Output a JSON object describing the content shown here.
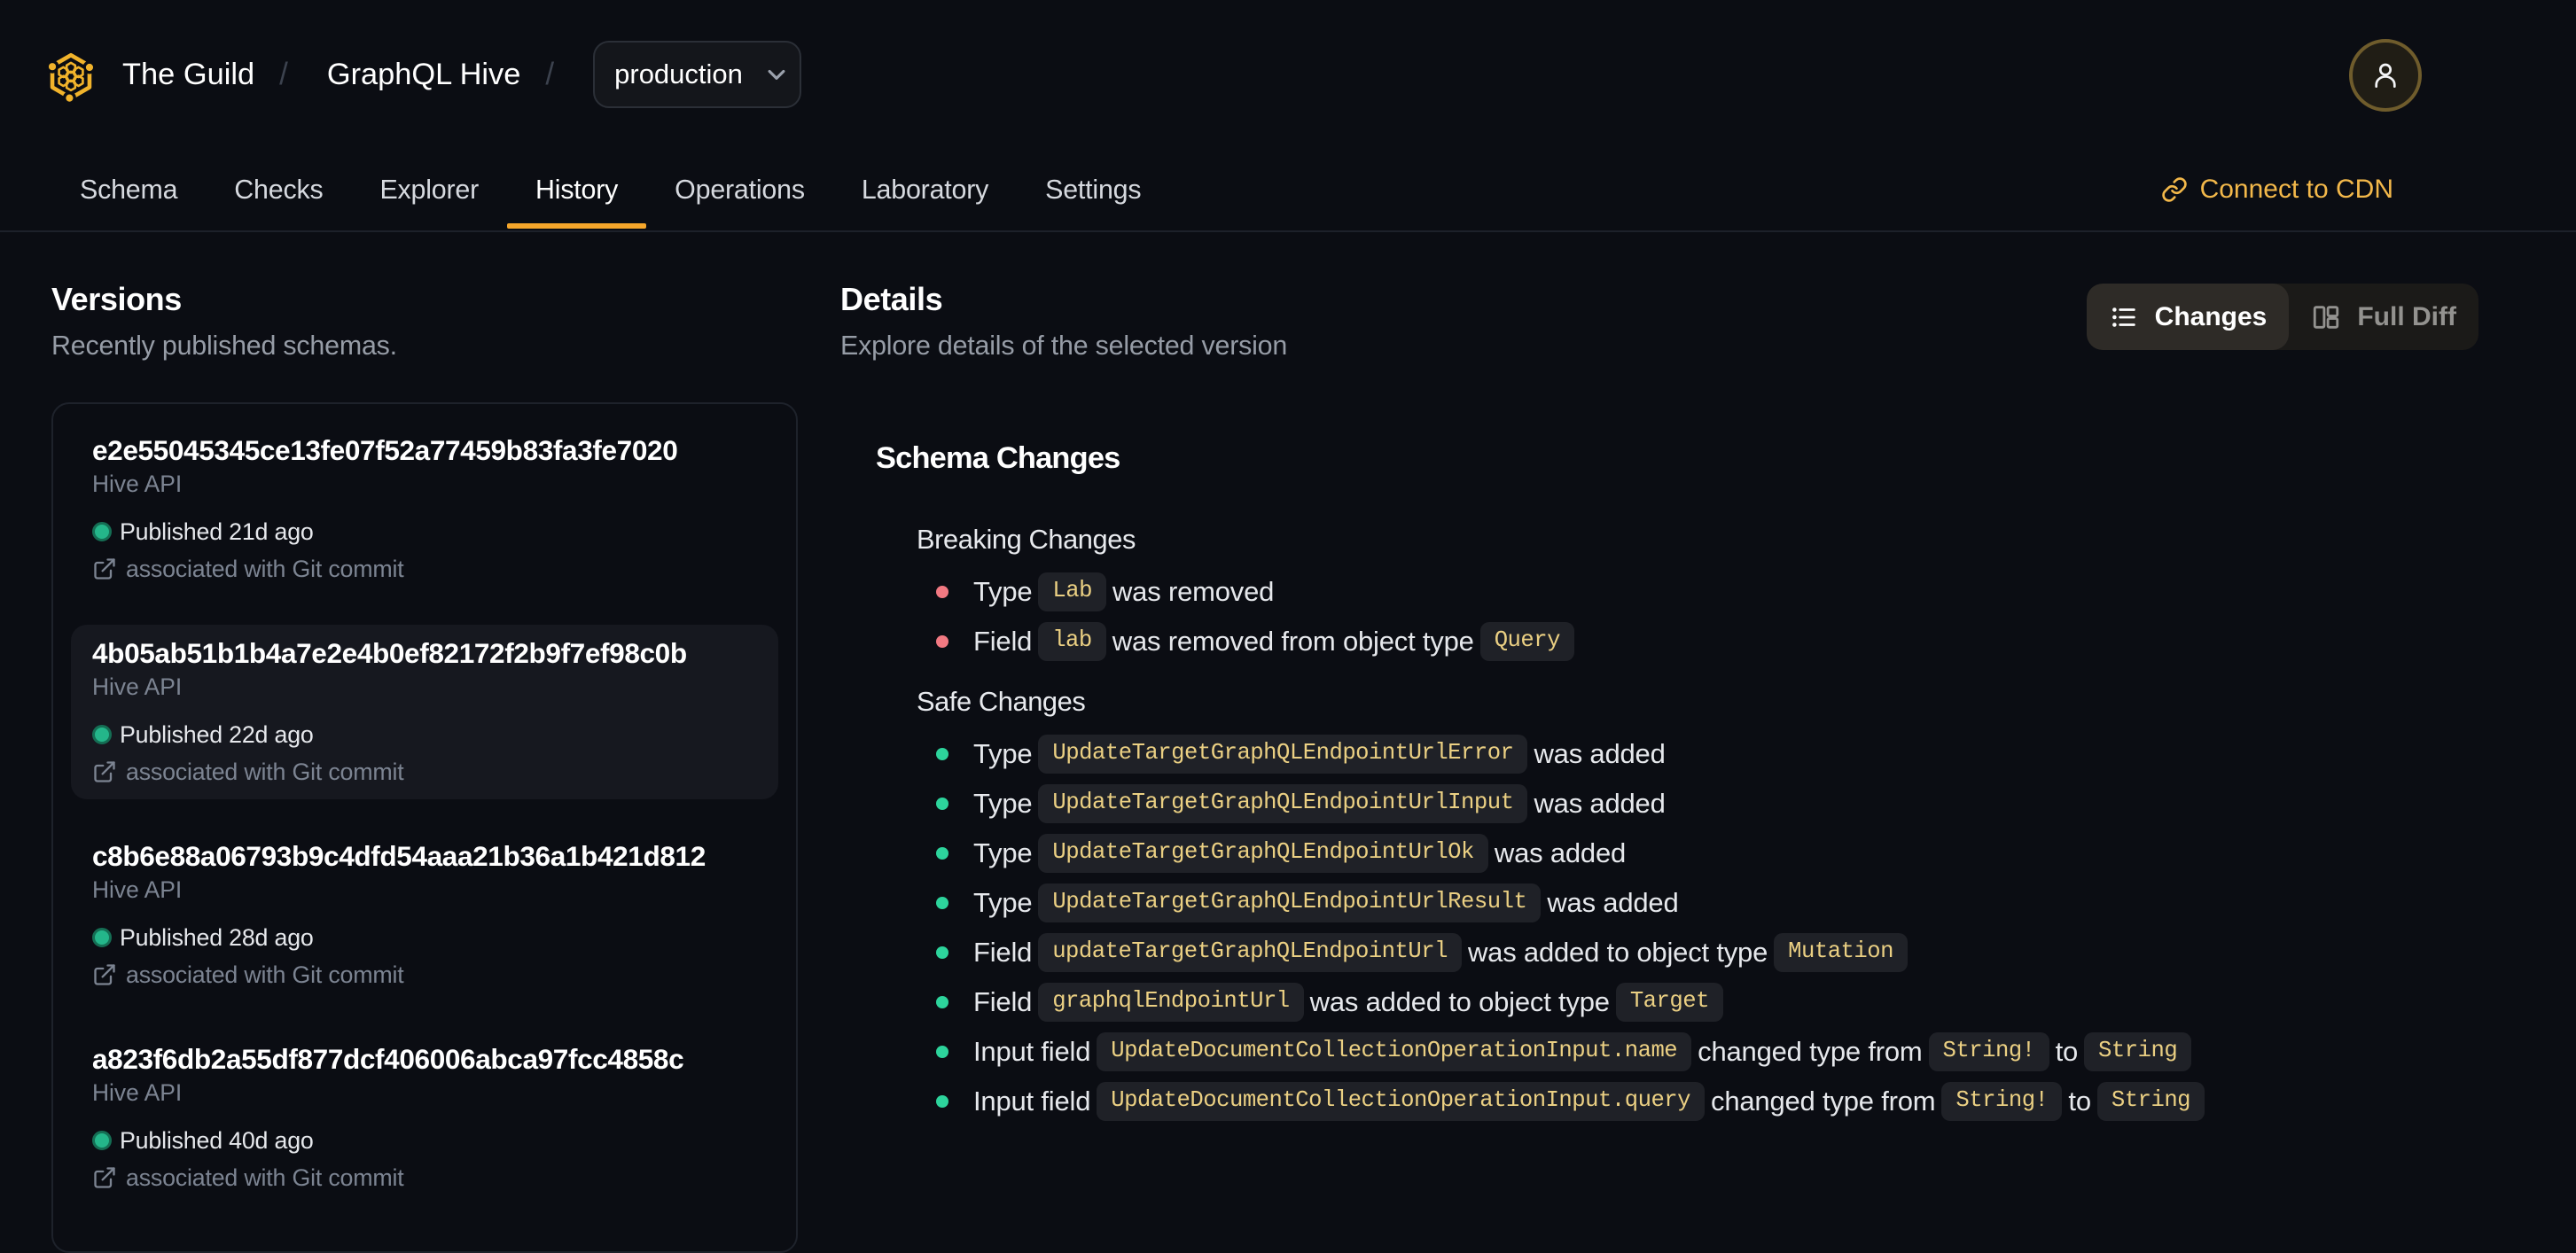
{
  "colors": {
    "background": "#0b0d13",
    "brand_yellow": "#f1b32b",
    "tab_underline": "#f5a62b",
    "cdn_link": "#f3b84a",
    "chip_text": "#ebd083",
    "breaking_bullet": "#f27982",
    "safe_bullet": "#2dd49c",
    "published_dot": "#24b68a"
  },
  "header": {
    "org": "The Guild",
    "project": "GraphQL Hive",
    "separator": "/",
    "target_selector": {
      "value": "production"
    },
    "icons": {
      "logo": "hive-honeycomb",
      "avatar": "person"
    }
  },
  "nav": {
    "tabs": [
      {
        "label": "Schema",
        "active": false
      },
      {
        "label": "Checks",
        "active": false
      },
      {
        "label": "Explorer",
        "active": false
      },
      {
        "label": "History",
        "active": true
      },
      {
        "label": "Operations",
        "active": false
      },
      {
        "label": "Laboratory",
        "active": false
      },
      {
        "label": "Settings",
        "active": false
      }
    ],
    "cdn_link": {
      "label": "Connect to CDN",
      "icon": "link"
    }
  },
  "versions": {
    "title": "Versions",
    "subtitle": "Recently published schemas.",
    "items": [
      {
        "hash": "e2e55045345ce13fe07f52a77459b83fa3fe7020",
        "service": "Hive API",
        "published": "Published 21d ago",
        "git": "associated with Git commit",
        "selected": false
      },
      {
        "hash": "4b05ab51b1b4a7e2e4b0ef82172f2b9f7ef98c0b",
        "service": "Hive API",
        "published": "Published 22d ago",
        "git": "associated with Git commit",
        "selected": true
      },
      {
        "hash": "c8b6e88a06793b9c4dfd54aaa21b36a1b421d812",
        "service": "Hive API",
        "published": "Published 28d ago",
        "git": "associated with Git commit",
        "selected": false
      },
      {
        "hash": "a823f6db2a55df877dcf406006abca97fcc4858c",
        "service": "Hive API",
        "published": "Published 40d ago",
        "git": "associated with Git commit",
        "selected": false
      }
    ]
  },
  "details": {
    "title": "Details",
    "subtitle": "Explore details of the selected version",
    "view_toggle": [
      {
        "label": "Changes",
        "icon": "list",
        "active": true
      },
      {
        "label": "Full Diff",
        "icon": "columns",
        "active": false
      }
    ],
    "schema_changes": {
      "title": "Schema Changes",
      "groups": [
        {
          "title": "Breaking Changes",
          "kind": "breaking",
          "items": [
            [
              {
                "t": "text",
                "v": "Type"
              },
              {
                "t": "code",
                "v": "Lab"
              },
              {
                "t": "text",
                "v": "was removed"
              }
            ],
            [
              {
                "t": "text",
                "v": "Field"
              },
              {
                "t": "code",
                "v": "lab"
              },
              {
                "t": "text",
                "v": "was removed from object type"
              },
              {
                "t": "code",
                "v": "Query"
              }
            ]
          ]
        },
        {
          "title": "Safe Changes",
          "kind": "safe",
          "items": [
            [
              {
                "t": "text",
                "v": "Type"
              },
              {
                "t": "code",
                "v": "UpdateTargetGraphQLEndpointUrlError"
              },
              {
                "t": "text",
                "v": "was added"
              }
            ],
            [
              {
                "t": "text",
                "v": "Type"
              },
              {
                "t": "code",
                "v": "UpdateTargetGraphQLEndpointUrlInput"
              },
              {
                "t": "text",
                "v": "was added"
              }
            ],
            [
              {
                "t": "text",
                "v": "Type"
              },
              {
                "t": "code",
                "v": "UpdateTargetGraphQLEndpointUrlOk"
              },
              {
                "t": "text",
                "v": "was added"
              }
            ],
            [
              {
                "t": "text",
                "v": "Type"
              },
              {
                "t": "code",
                "v": "UpdateTargetGraphQLEndpointUrlResult"
              },
              {
                "t": "text",
                "v": "was added"
              }
            ],
            [
              {
                "t": "text",
                "v": "Field"
              },
              {
                "t": "code",
                "v": "updateTargetGraphQLEndpointUrl"
              },
              {
                "t": "text",
                "v": "was added to object type"
              },
              {
                "t": "code",
                "v": "Mutation"
              }
            ],
            [
              {
                "t": "text",
                "v": "Field"
              },
              {
                "t": "code",
                "v": "graphqlEndpointUrl"
              },
              {
                "t": "text",
                "v": "was added to object type"
              },
              {
                "t": "code",
                "v": "Target"
              }
            ],
            [
              {
                "t": "text",
                "v": "Input field"
              },
              {
                "t": "code",
                "v": "UpdateDocumentCollectionOperationInput.name"
              },
              {
                "t": "text",
                "v": "changed type from"
              },
              {
                "t": "code",
                "v": "String!"
              },
              {
                "t": "text",
                "v": "to"
              },
              {
                "t": "code",
                "v": "String"
              }
            ],
            [
              {
                "t": "text",
                "v": "Input field"
              },
              {
                "t": "code",
                "v": "UpdateDocumentCollectionOperationInput.query"
              },
              {
                "t": "text",
                "v": "changed type from"
              },
              {
                "t": "code",
                "v": "String!"
              },
              {
                "t": "text",
                "v": "to"
              },
              {
                "t": "code",
                "v": "String"
              }
            ]
          ]
        }
      ]
    }
  }
}
